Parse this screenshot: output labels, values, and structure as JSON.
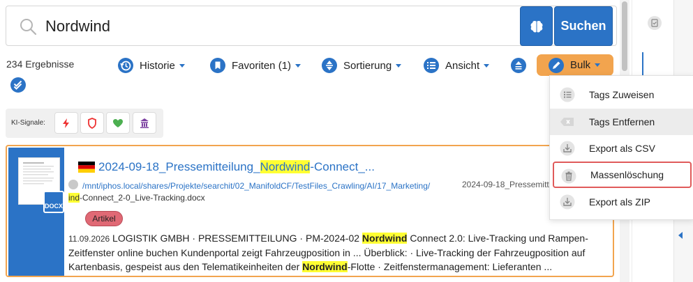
{
  "search": {
    "query": "Nordwind",
    "button_label": "Suchen"
  },
  "results": {
    "count_label": "234 Ergebnisse"
  },
  "toolbar": {
    "historie": "Historie",
    "favoriten": "Favoriten (1)",
    "sortierung": "Sortierung",
    "ansicht": "Ansicht",
    "bulk": "Bulk"
  },
  "ki_signals": {
    "label": "KI-Signale:"
  },
  "result": {
    "title_pre": "2024-09-18_Pressemitteilung_",
    "title_hl": "Nordwind",
    "title_post": "-Connect_...",
    "path_line1": "/mnt/iphos.local/shares/Projekte/searchit/02_ManifoldCF/TestFiles_Crawling/AI/17_Marketing/",
    "path_hl": "ind",
    "path_line2": "-Connect_2-0_Live-Tracking.docx",
    "filename_right": "2024-09-18_Pressemitte",
    "tag": "Artikel",
    "doc_badge": "DOCX",
    "snippet_date": "11.09.2026",
    "snippet_1": "  LOGISTIK GMBH · PRESSEMITTEILUNG · PM-2024-02 ",
    "snippet_hl1": "Nordwind",
    "snippet_2": " Connect 2.0: Live-Tracking und Rampen-Zeitfenster online buchen Kundenportal zeigt Fahrzeugposition in ... Überblick: · Live-Tracking der Fahrzeugposition auf Kartenbasis, gespeist aus den Telematikeinheiten der ",
    "snippet_hl2": "Nordwind",
    "snippet_3": "-Flotte · Zeitfenstermanagement: Lieferanten ..."
  },
  "bulk_menu": {
    "items": [
      {
        "label": "Tags Zuweisen",
        "icon": "list-check-icon"
      },
      {
        "label": "Tags Entfernen",
        "icon": "tag-remove-icon"
      },
      {
        "label": "Export als CSV",
        "icon": "download-icon"
      },
      {
        "label": "Massenlöschung",
        "icon": "trash-icon"
      },
      {
        "label": "Export als ZIP",
        "icon": "download-icon"
      }
    ]
  },
  "colors": {
    "primary": "#2b73c6",
    "bulk_orange": "#f2a44e",
    "highlight": "#ffff33",
    "tag_red": "#e06975",
    "danger_border": "#e05a5a"
  }
}
